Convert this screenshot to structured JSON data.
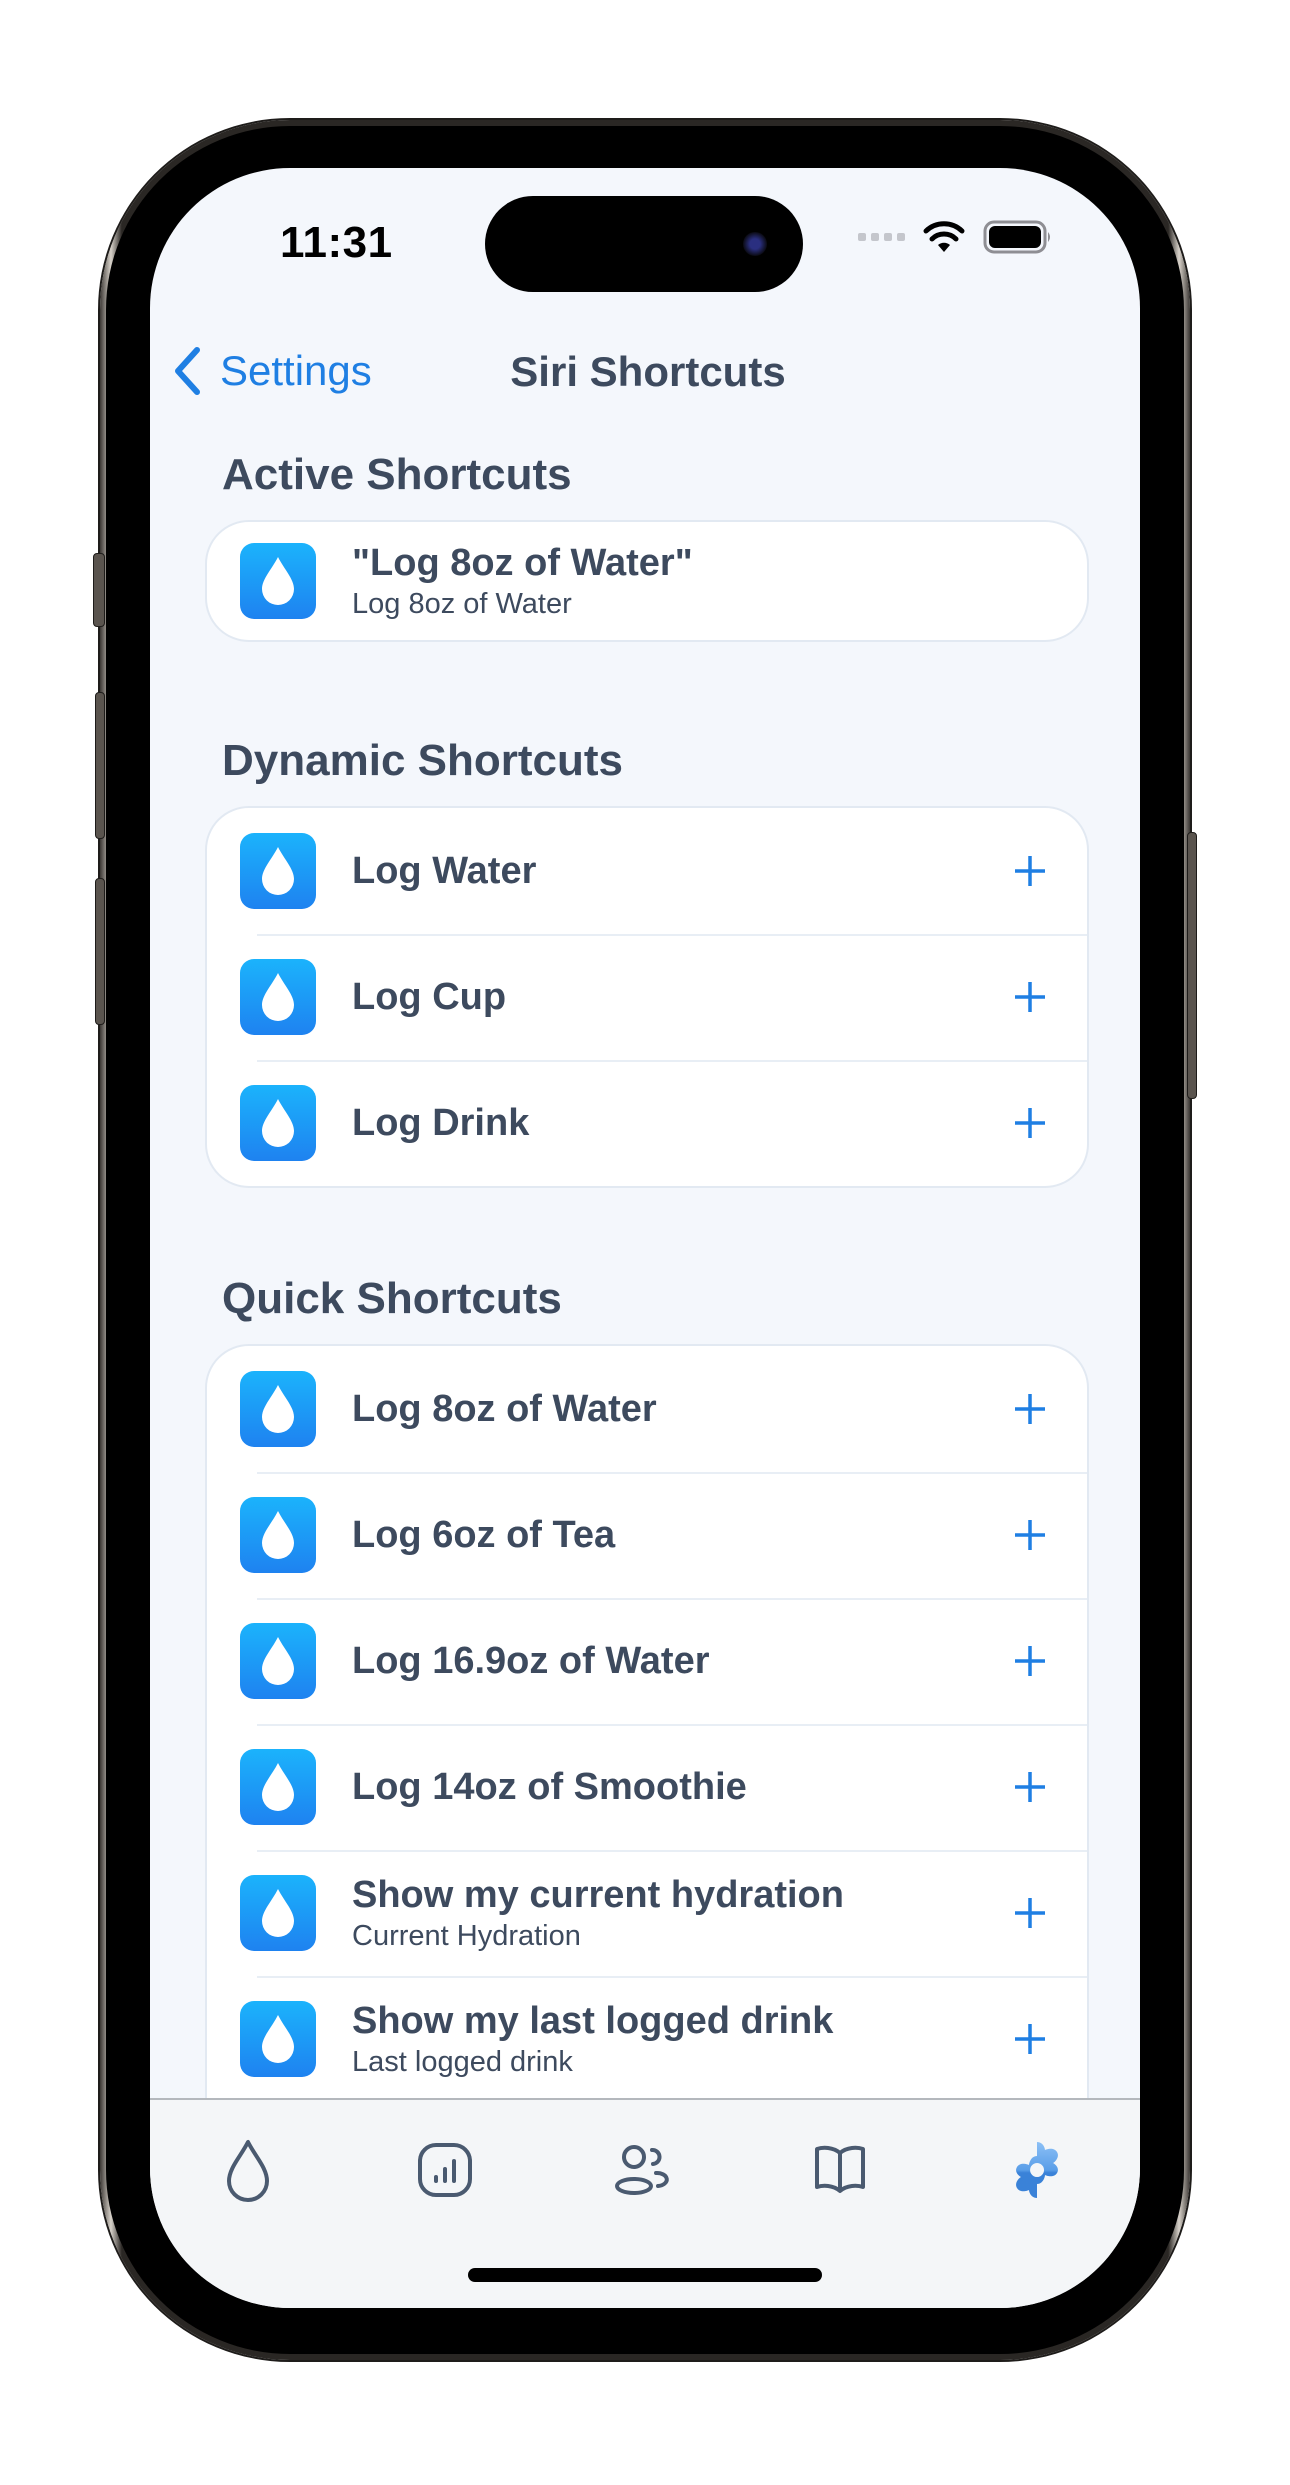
{
  "status_bar": {
    "time": "11:31",
    "icons": [
      "cellular-dots-icon",
      "wifi-icon",
      "battery-icon"
    ]
  },
  "nav": {
    "back_label": "Settings",
    "title": "Siri Shortcuts"
  },
  "sections": {
    "active": {
      "title": "Active Shortcuts",
      "items": [
        {
          "title": "\"Log 8oz of Water\"",
          "subtitle": "Log 8oz of Water",
          "icon": "water-drop-icon"
        }
      ]
    },
    "dynamic": {
      "title": "Dynamic Shortcuts",
      "items": [
        {
          "title": "Log Water",
          "icon": "water-drop-icon",
          "action": "plus-icon"
        },
        {
          "title": "Log Cup",
          "icon": "water-drop-icon",
          "action": "plus-icon"
        },
        {
          "title": "Log Drink",
          "icon": "water-drop-icon",
          "action": "plus-icon"
        }
      ]
    },
    "quick": {
      "title": "Quick Shortcuts",
      "items": [
        {
          "title": "Log 8oz of Water",
          "icon": "water-drop-icon",
          "action": "plus-icon"
        },
        {
          "title": "Log 6oz of Tea",
          "icon": "water-drop-icon",
          "action": "plus-icon"
        },
        {
          "title": "Log 16.9oz of Water",
          "icon": "water-drop-icon",
          "action": "plus-icon"
        },
        {
          "title": "Log 14oz of Smoothie",
          "icon": "water-drop-icon",
          "action": "plus-icon"
        },
        {
          "title": "Show my current hydration",
          "subtitle": "Current Hydration",
          "icon": "water-drop-icon",
          "action": "plus-icon"
        },
        {
          "title": "Show my last logged drink",
          "subtitle": "Last logged drink",
          "icon": "water-drop-icon",
          "action": "plus-icon"
        }
      ]
    }
  },
  "tab_bar": {
    "tabs": [
      {
        "icon": "water-drop-outline-icon",
        "selected": false
      },
      {
        "icon": "chart-bars-icon",
        "selected": false
      },
      {
        "icon": "people-icon",
        "selected": false
      },
      {
        "icon": "book-icon",
        "selected": false
      },
      {
        "icon": "gear-icon",
        "selected": true
      }
    ]
  },
  "colors": {
    "accent": "#1f7fe3",
    "text": "#3d4a5e",
    "background": "#f4f7fc",
    "icon_gradient_top": "#1bb3fc",
    "icon_gradient_bottom": "#1e82f0",
    "tab_inactive": "#4a5a70",
    "tab_active": "#3a82d8"
  }
}
